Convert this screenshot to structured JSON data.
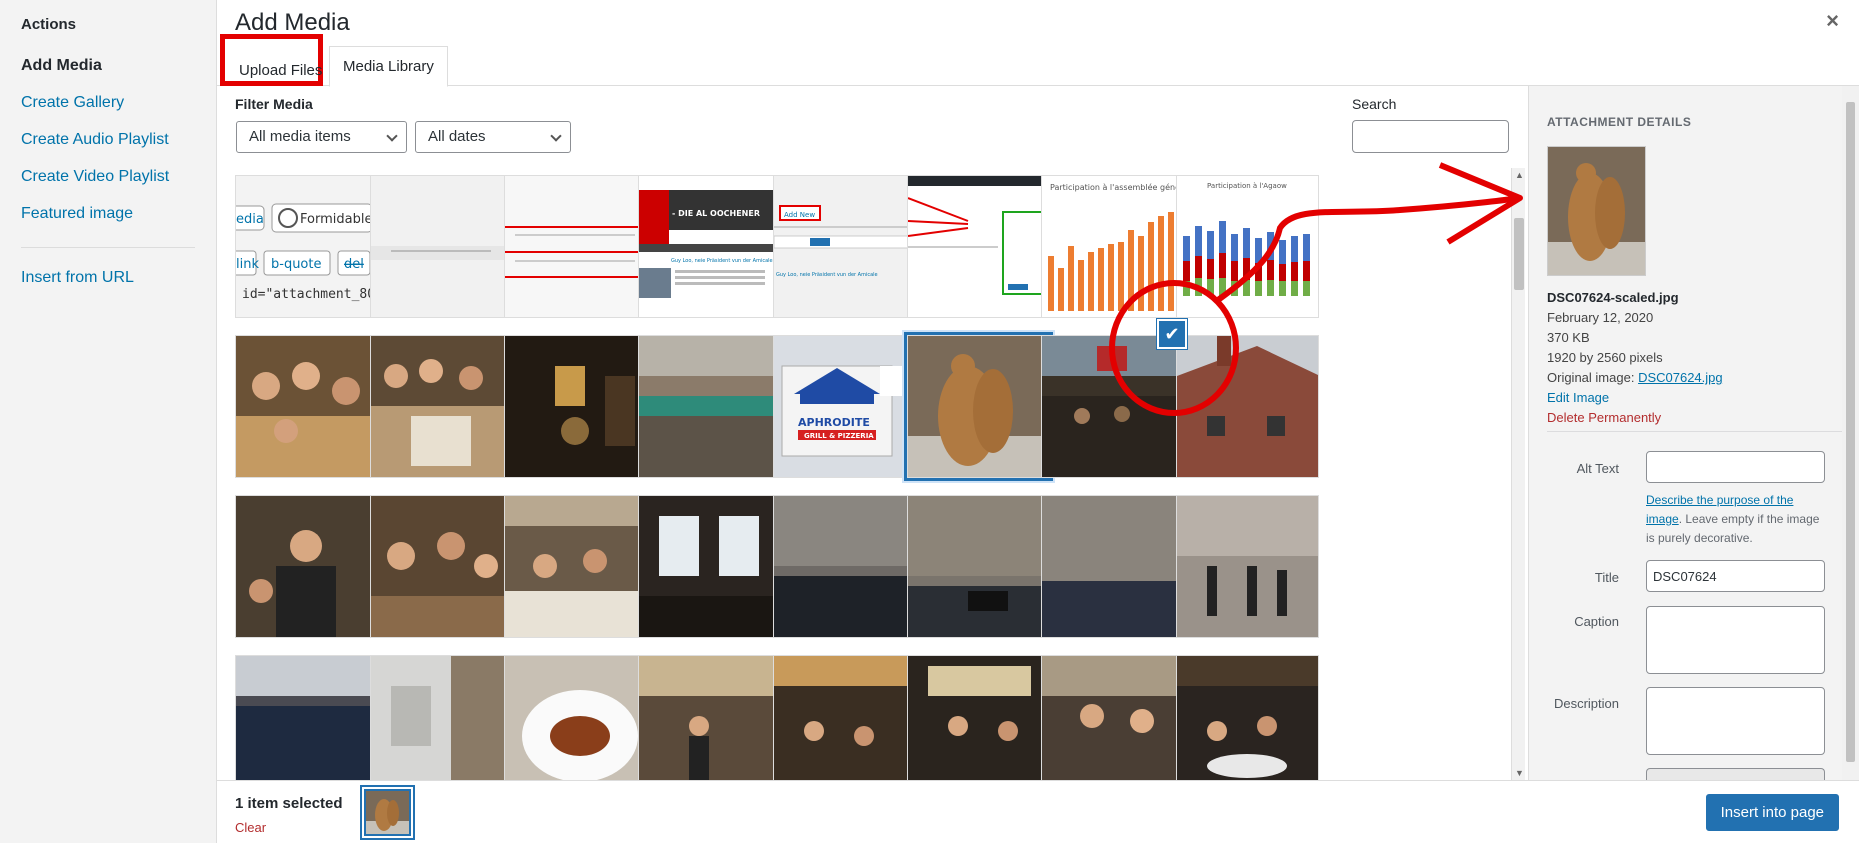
{
  "menu": {
    "heading": "Actions",
    "items": [
      {
        "label": "Add Media",
        "active": true
      },
      {
        "label": "Create Gallery"
      },
      {
        "label": "Create Audio Playlist"
      },
      {
        "label": "Create Video Playlist"
      },
      {
        "label": "Featured image"
      }
    ],
    "insert_from_url": "Insert from URL"
  },
  "modal": {
    "title": "Add Media",
    "close_icon": "×",
    "tabs": {
      "upload": "Upload Files",
      "library": "Media Library"
    }
  },
  "toolbar": {
    "filter_label": "Filter Media",
    "type_filter": "All media items",
    "date_filter": "All dates",
    "search_label": "Search",
    "search_value": ""
  },
  "grid": {
    "thumb_texts": {
      "t1": [
        "edia",
        "Formidable",
        "link",
        "b-quote",
        "del",
        "id=\"attachment_80"
      ],
      "t4": [
        "- DIE AL OOCHENER",
        "Guy Loo, neie Präsident vun der Amicale"
      ],
      "t5": [
        "Add New",
        "Guy Loo, neie Präsident vun der Amicale"
      ],
      "t7": "Participation à l'assemblée générale",
      "t8": "Participation à l'Agaow",
      "t13": [
        "APHRODITE",
        "GRILL & PIZZERIA"
      ]
    },
    "selected_check": "✔"
  },
  "details": {
    "heading": "ATTACHMENT DETAILS",
    "filename": "DSC07624-scaled.jpg",
    "date": "February 12, 2020",
    "size": "370 KB",
    "dimensions": "1920 by 2560 pixels",
    "original_label": "Original image:",
    "original_link": "DSC07624.jpg",
    "edit_image": "Edit Image",
    "delete": "Delete Permanently",
    "alt_label": "Alt Text",
    "alt_value": "",
    "help_link": "Describe the purpose of the image",
    "help_text": ". Leave empty if the image is purely decorative.",
    "title_label": "Title",
    "title_value": "DSC07624",
    "caption_label": "Caption",
    "caption_value": "",
    "description_label": "Description",
    "description_value": ""
  },
  "bottom": {
    "selected_count": "1 item selected",
    "clear": "Clear",
    "insert_button": "Insert into page"
  },
  "colors": {
    "accent": "#2271b1",
    "annotation": "#e30000",
    "danger": "#b32d2e",
    "link": "#0073aa"
  }
}
